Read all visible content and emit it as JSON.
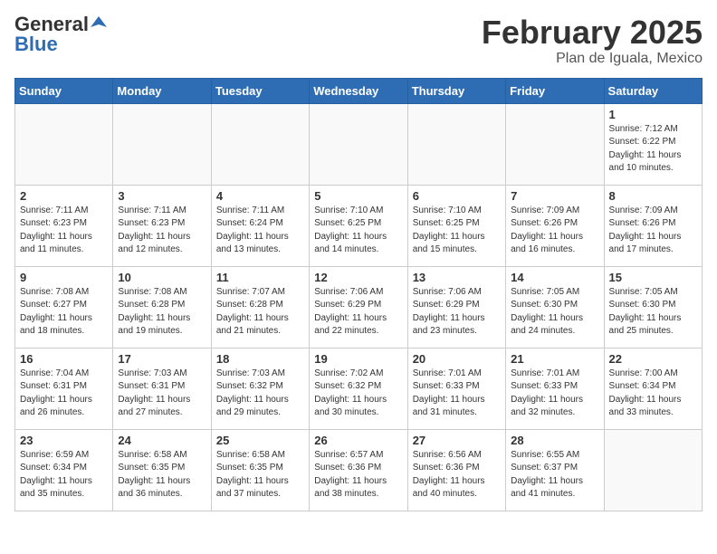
{
  "header": {
    "logo_general": "General",
    "logo_blue": "Blue",
    "month_year": "February 2025",
    "location": "Plan de Iguala, Mexico"
  },
  "weekdays": [
    "Sunday",
    "Monday",
    "Tuesday",
    "Wednesday",
    "Thursday",
    "Friday",
    "Saturday"
  ],
  "weeks": [
    [
      {
        "day": "",
        "info": ""
      },
      {
        "day": "",
        "info": ""
      },
      {
        "day": "",
        "info": ""
      },
      {
        "day": "",
        "info": ""
      },
      {
        "day": "",
        "info": ""
      },
      {
        "day": "",
        "info": ""
      },
      {
        "day": "1",
        "info": "Sunrise: 7:12 AM\nSunset: 6:22 PM\nDaylight: 11 hours\nand 10 minutes."
      }
    ],
    [
      {
        "day": "2",
        "info": "Sunrise: 7:11 AM\nSunset: 6:23 PM\nDaylight: 11 hours\nand 11 minutes."
      },
      {
        "day": "3",
        "info": "Sunrise: 7:11 AM\nSunset: 6:23 PM\nDaylight: 11 hours\nand 12 minutes."
      },
      {
        "day": "4",
        "info": "Sunrise: 7:11 AM\nSunset: 6:24 PM\nDaylight: 11 hours\nand 13 minutes."
      },
      {
        "day": "5",
        "info": "Sunrise: 7:10 AM\nSunset: 6:25 PM\nDaylight: 11 hours\nand 14 minutes."
      },
      {
        "day": "6",
        "info": "Sunrise: 7:10 AM\nSunset: 6:25 PM\nDaylight: 11 hours\nand 15 minutes."
      },
      {
        "day": "7",
        "info": "Sunrise: 7:09 AM\nSunset: 6:26 PM\nDaylight: 11 hours\nand 16 minutes."
      },
      {
        "day": "8",
        "info": "Sunrise: 7:09 AM\nSunset: 6:26 PM\nDaylight: 11 hours\nand 17 minutes."
      }
    ],
    [
      {
        "day": "9",
        "info": "Sunrise: 7:08 AM\nSunset: 6:27 PM\nDaylight: 11 hours\nand 18 minutes."
      },
      {
        "day": "10",
        "info": "Sunrise: 7:08 AM\nSunset: 6:28 PM\nDaylight: 11 hours\nand 19 minutes."
      },
      {
        "day": "11",
        "info": "Sunrise: 7:07 AM\nSunset: 6:28 PM\nDaylight: 11 hours\nand 21 minutes."
      },
      {
        "day": "12",
        "info": "Sunrise: 7:06 AM\nSunset: 6:29 PM\nDaylight: 11 hours\nand 22 minutes."
      },
      {
        "day": "13",
        "info": "Sunrise: 7:06 AM\nSunset: 6:29 PM\nDaylight: 11 hours\nand 23 minutes."
      },
      {
        "day": "14",
        "info": "Sunrise: 7:05 AM\nSunset: 6:30 PM\nDaylight: 11 hours\nand 24 minutes."
      },
      {
        "day": "15",
        "info": "Sunrise: 7:05 AM\nSunset: 6:30 PM\nDaylight: 11 hours\nand 25 minutes."
      }
    ],
    [
      {
        "day": "16",
        "info": "Sunrise: 7:04 AM\nSunset: 6:31 PM\nDaylight: 11 hours\nand 26 minutes."
      },
      {
        "day": "17",
        "info": "Sunrise: 7:03 AM\nSunset: 6:31 PM\nDaylight: 11 hours\nand 27 minutes."
      },
      {
        "day": "18",
        "info": "Sunrise: 7:03 AM\nSunset: 6:32 PM\nDaylight: 11 hours\nand 29 minutes."
      },
      {
        "day": "19",
        "info": "Sunrise: 7:02 AM\nSunset: 6:32 PM\nDaylight: 11 hours\nand 30 minutes."
      },
      {
        "day": "20",
        "info": "Sunrise: 7:01 AM\nSunset: 6:33 PM\nDaylight: 11 hours\nand 31 minutes."
      },
      {
        "day": "21",
        "info": "Sunrise: 7:01 AM\nSunset: 6:33 PM\nDaylight: 11 hours\nand 32 minutes."
      },
      {
        "day": "22",
        "info": "Sunrise: 7:00 AM\nSunset: 6:34 PM\nDaylight: 11 hours\nand 33 minutes."
      }
    ],
    [
      {
        "day": "23",
        "info": "Sunrise: 6:59 AM\nSunset: 6:34 PM\nDaylight: 11 hours\nand 35 minutes."
      },
      {
        "day": "24",
        "info": "Sunrise: 6:58 AM\nSunset: 6:35 PM\nDaylight: 11 hours\nand 36 minutes."
      },
      {
        "day": "25",
        "info": "Sunrise: 6:58 AM\nSunset: 6:35 PM\nDaylight: 11 hours\nand 37 minutes."
      },
      {
        "day": "26",
        "info": "Sunrise: 6:57 AM\nSunset: 6:36 PM\nDaylight: 11 hours\nand 38 minutes."
      },
      {
        "day": "27",
        "info": "Sunrise: 6:56 AM\nSunset: 6:36 PM\nDaylight: 11 hours\nand 40 minutes."
      },
      {
        "day": "28",
        "info": "Sunrise: 6:55 AM\nSunset: 6:37 PM\nDaylight: 11 hours\nand 41 minutes."
      },
      {
        "day": "",
        "info": ""
      }
    ]
  ]
}
